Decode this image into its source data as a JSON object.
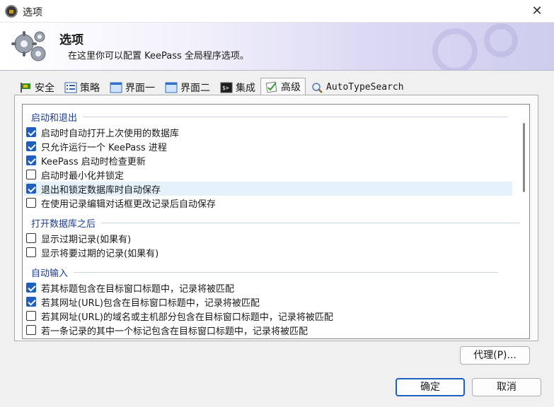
{
  "window": {
    "title": "选项",
    "close_glyph": "✕"
  },
  "banner": {
    "title": "选项",
    "subtitle": "在这里你可以配置 KeePass 全局程序选项。"
  },
  "tabs": [
    {
      "label": "安全",
      "icon": "security-flag-icon",
      "active": false
    },
    {
      "label": "策略",
      "icon": "policy-list-icon",
      "active": false
    },
    {
      "label": "界面一",
      "icon": "window-icon",
      "active": false
    },
    {
      "label": "界面二",
      "icon": "window-icon",
      "active": false
    },
    {
      "label": "集成",
      "icon": "console-icon",
      "active": false
    },
    {
      "label": "高级",
      "icon": "checklist-icon",
      "active": true
    },
    {
      "label": "AutoTypeSearch",
      "icon": "magnifier-icon",
      "active": false
    }
  ],
  "groups": [
    {
      "header": "启动和退出",
      "items": [
        {
          "label": "启动时自动打开上次使用的数据库",
          "checked": true,
          "selected": false
        },
        {
          "label": "只允许运行一个 KeePass 进程",
          "checked": true,
          "selected": false
        },
        {
          "label": "KeePass 启动时检查更新",
          "checked": true,
          "selected": false
        },
        {
          "label": "启动时最小化并锁定",
          "checked": false,
          "selected": false
        },
        {
          "label": "退出和锁定数据库时自动保存",
          "checked": true,
          "selected": true
        },
        {
          "label": "在使用记录编辑对话框更改记录后自动保存",
          "checked": false,
          "selected": false
        }
      ]
    },
    {
      "header": "打开数据库之后",
      "items": [
        {
          "label": "显示过期记录(如果有)",
          "checked": false,
          "selected": false
        },
        {
          "label": "显示将要过期的记录(如果有)",
          "checked": false,
          "selected": false
        }
      ]
    },
    {
      "header": "自动输入",
      "items": [
        {
          "label": "若其标题包含在目标窗口标题中，记录将被匹配",
          "checked": true,
          "selected": false
        },
        {
          "label": "若其网址(URL)包含在目标窗口标题中，记录将被匹配",
          "checked": true,
          "selected": false
        },
        {
          "label": "若其网址(URL)的域名或主机部分包含在目标窗口标题中，记录将被匹配",
          "checked": false,
          "selected": false
        },
        {
          "label": "若一条记录的其中一个标记包含在目标窗口标题中，记录将被匹配",
          "checked": false,
          "selected": false
        },
        {
          "label": "",
          "checked": true,
          "selected": false
        }
      ]
    }
  ],
  "scroll": {
    "position_fraction": 0.0
  },
  "buttons": {
    "proxy": "代理(P)...",
    "ok": "确定",
    "cancel": "取消"
  },
  "colors": {
    "accent": "#1f5fbf",
    "group_header": "#1e3c8c",
    "selection": "#e5f1fb"
  }
}
